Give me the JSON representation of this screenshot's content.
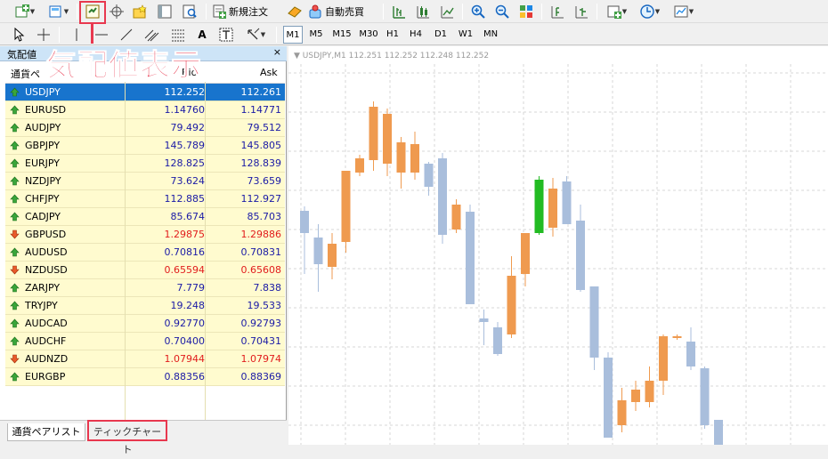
{
  "toolbar": {
    "new_order_label": "新規注文",
    "auto_trade_label": "自動売買"
  },
  "timeframes": [
    "M1",
    "M5",
    "M15",
    "M30",
    "H1",
    "H4",
    "D1",
    "W1",
    "MN"
  ],
  "selected_timeframe": "M1",
  "market_watch": {
    "title": "気配値",
    "close": "×",
    "columns": {
      "symbol": "通貨ペ",
      "bid": "Bid",
      "ask": "Ask"
    },
    "rows": [
      {
        "symbol": "USDJPY",
        "bid": "112.252",
        "ask": "112.261",
        "dir": "up",
        "selected": true
      },
      {
        "symbol": "EURUSD",
        "bid": "1.14760",
        "ask": "1.14771",
        "dir": "up"
      },
      {
        "symbol": "AUDJPY",
        "bid": "79.492",
        "ask": "79.512",
        "dir": "up"
      },
      {
        "symbol": "GBPJPY",
        "bid": "145.789",
        "ask": "145.805",
        "dir": "up"
      },
      {
        "symbol": "EURJPY",
        "bid": "128.825",
        "ask": "128.839",
        "dir": "up"
      },
      {
        "symbol": "NZDJPY",
        "bid": "73.624",
        "ask": "73.659",
        "dir": "up"
      },
      {
        "symbol": "CHFJPY",
        "bid": "112.885",
        "ask": "112.927",
        "dir": "up"
      },
      {
        "symbol": "CADJPY",
        "bid": "85.674",
        "ask": "85.703",
        "dir": "up"
      },
      {
        "symbol": "GBPUSD",
        "bid": "1.29875",
        "ask": "1.29886",
        "dir": "down"
      },
      {
        "symbol": "AUDUSD",
        "bid": "0.70816",
        "ask": "0.70831",
        "dir": "up"
      },
      {
        "symbol": "NZDUSD",
        "bid": "0.65594",
        "ask": "0.65608",
        "dir": "down"
      },
      {
        "symbol": "ZARJPY",
        "bid": "7.779",
        "ask": "7.838",
        "dir": "up"
      },
      {
        "symbol": "TRYJPY",
        "bid": "19.248",
        "ask": "19.533",
        "dir": "up"
      },
      {
        "symbol": "AUDCAD",
        "bid": "0.92770",
        "ask": "0.92793",
        "dir": "up"
      },
      {
        "symbol": "AUDCHF",
        "bid": "0.70400",
        "ask": "0.70431",
        "dir": "up"
      },
      {
        "symbol": "AUDNZD",
        "bid": "1.07944",
        "ask": "1.07974",
        "dir": "down"
      },
      {
        "symbol": "EURGBP",
        "bid": "0.88356",
        "ask": "0.88369",
        "dir": "up"
      }
    ],
    "tabs": [
      "通貨ペアリスト",
      "ティックチャート"
    ]
  },
  "chart": {
    "title": "USDJPY,M1  112.251 112.252 112.248 112.252"
  },
  "annotation": {
    "overlay_text": "気配値表示"
  },
  "colors": {
    "up_price": "#1a1aa6",
    "down_price": "#e11c1c",
    "selected_row": "#1874cd",
    "row_bg": "#fffbcf",
    "bull_candle": "#a9bedc",
    "bear_candle": "#ef9a4f",
    "annotation": "#e8384f"
  }
}
